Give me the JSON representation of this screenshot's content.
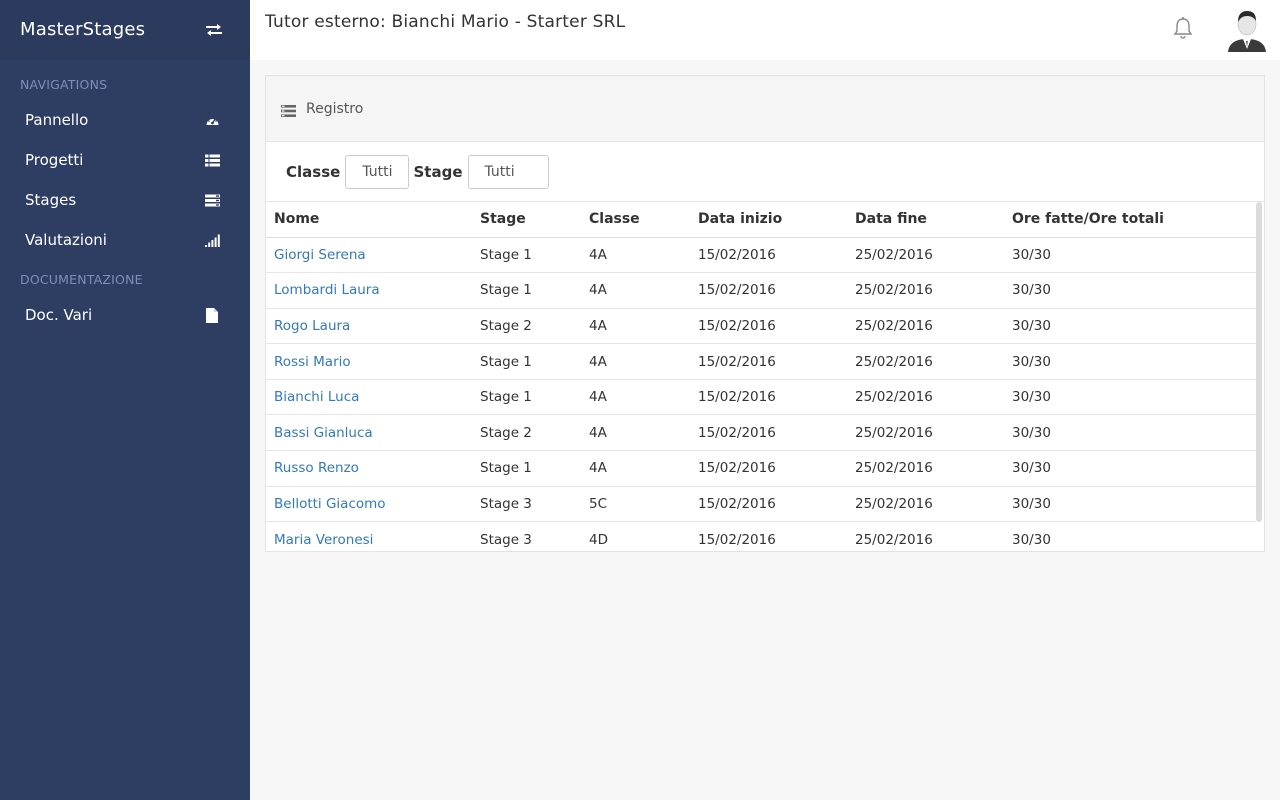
{
  "app": {
    "brand": "MasterStages"
  },
  "sidebar": {
    "section_navigations": "NAVIGATIONS",
    "section_documentazione": "DOCUMENTAZIONE",
    "items": [
      {
        "label": "Pannello",
        "icon": "dashboard-icon"
      },
      {
        "label": "Progetti",
        "icon": "list-icon"
      },
      {
        "label": "Stages",
        "icon": "stages-icon"
      },
      {
        "label": "Valutazioni",
        "icon": "signal-bars-icon"
      },
      {
        "label": "Doc. Vari",
        "icon": "file-icon"
      }
    ]
  },
  "header": {
    "title": "Tutor esterno: Bianchi Mario - Starter SRL"
  },
  "panel": {
    "title": "Registro",
    "filters": {
      "classe_label": "Classe",
      "classe_value": "Tutti",
      "stage_label": "Stage",
      "stage_value": "Tutti"
    },
    "columns": [
      "Nome",
      "Stage",
      "Classe",
      "Data inizio",
      "Data fine",
      "Ore fatte/Ore totali"
    ],
    "rows": [
      [
        "Giorgi Serena",
        "Stage 1",
        "4A",
        "15/02/2016",
        "25/02/2016",
        "30/30"
      ],
      [
        "Lombardi Laura",
        "Stage 1",
        "4A",
        "15/02/2016",
        "25/02/2016",
        "30/30"
      ],
      [
        "Rogo Laura",
        "Stage 2",
        "4A",
        "15/02/2016",
        "25/02/2016",
        "30/30"
      ],
      [
        "Rossi Mario",
        "Stage 1",
        "4A",
        "15/02/2016",
        "25/02/2016",
        "30/30"
      ],
      [
        "Bianchi Luca",
        "Stage 1",
        "4A",
        "15/02/2016",
        "25/02/2016",
        "30/30"
      ],
      [
        "Bassi Gianluca",
        "Stage 2",
        "4A",
        "15/02/2016",
        "25/02/2016",
        "30/30"
      ],
      [
        "Russo Renzo",
        "Stage 1",
        "4A",
        "15/02/2016",
        "25/02/2016",
        "30/30"
      ],
      [
        "Bellotti Giacomo",
        "Stage 3",
        "5C",
        "15/02/2016",
        "25/02/2016",
        "30/30"
      ],
      [
        "Maria Veronesi",
        "Stage 3",
        "4D",
        "15/02/2016",
        "25/02/2016",
        "30/30"
      ]
    ]
  }
}
